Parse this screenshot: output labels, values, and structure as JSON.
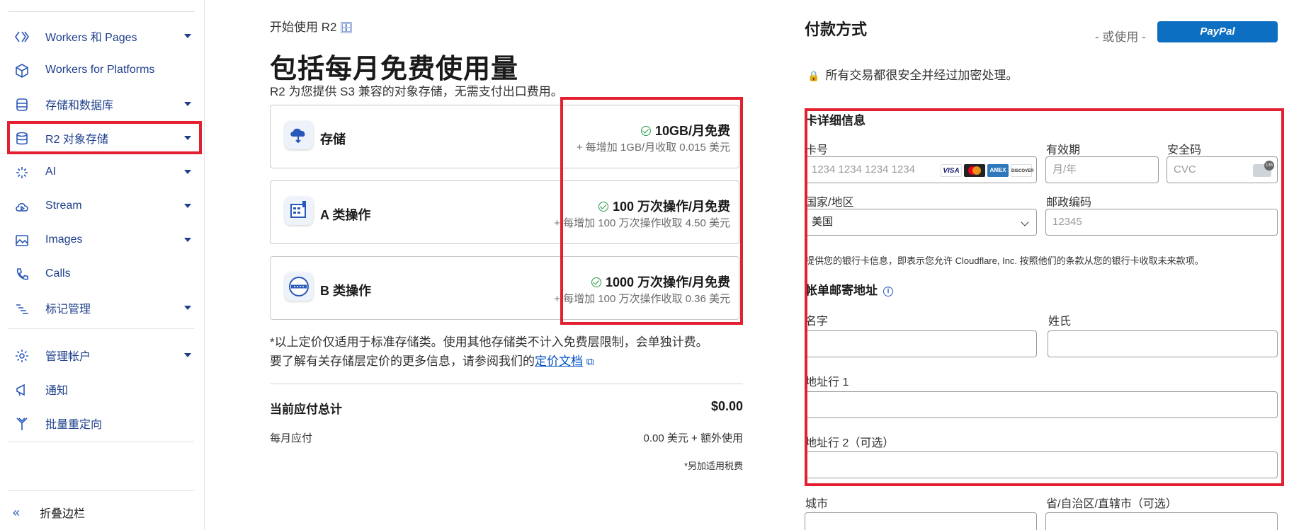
{
  "sidebar": {
    "items": [
      {
        "label": "Workers 和 Pages",
        "icon": "workers-icon"
      },
      {
        "label": "Workers for Platforms",
        "icon": "cube-icon"
      },
      {
        "label": "存储和数据库",
        "icon": "database-icon"
      },
      {
        "label": "R2 对象存储",
        "icon": "database-icon"
      },
      {
        "label": "AI",
        "icon": "sparkle-icon"
      },
      {
        "label": "Stream",
        "icon": "cloud-play-icon"
      },
      {
        "label": "Images",
        "icon": "image-icon"
      },
      {
        "label": "Calls",
        "icon": "phone-icon"
      },
      {
        "label": "标记管理",
        "icon": "tag-list-icon"
      },
      {
        "label": "管理帐户",
        "icon": "gear-icon"
      },
      {
        "label": "通知",
        "icon": "megaphone-icon"
      },
      {
        "label": "批量重定向",
        "icon": "redirect-icon"
      }
    ],
    "collapse_label": "折叠边栏"
  },
  "main": {
    "getting_started": "开始使用 R2",
    "title": "包括每月免费使用量",
    "description": "R2 为您提供 S3 兼容的对象存储，无需支付出口费用。",
    "plans": [
      {
        "name": "存储",
        "free": "10GB/月免费",
        "extra": "+ 每增加 1GB/月收取 0.015 美元"
      },
      {
        "name": "A 类操作",
        "free": "100 万次操作/月免费",
        "extra": "+ 每增加 100 万次操作收取 4.50 美元"
      },
      {
        "name": "B 类操作",
        "free": "1000 万次操作/月免费",
        "extra": "+ 每增加 100 万次操作收取 0.36 美元"
      }
    ],
    "footnote_line1": "*以上定价仅适用于标准存储类。使用其他存储类不计入免费层限制，会单独计费。",
    "footnote_line2": "要了解有关存储层定价的更多信息，请参阅我们的",
    "footnote_link": "定价文档",
    "total_label": "当前应付总计",
    "total_value": "$0.00",
    "monthly_label": "每月应付",
    "monthly_value": "0.00 美元 + 额外使用",
    "tax_note": "*另加适用税费"
  },
  "payment": {
    "title": "付款方式",
    "or_use": "- 或使用 -",
    "paypal": "PayPal",
    "secure_note": "所有交易都很安全并经过加密处理。",
    "card_section_title": "卡详细信息",
    "card_number_label": "卡号",
    "card_number_placeholder": "1234 1234 1234 1234",
    "expiry_label": "有效期",
    "expiry_placeholder": "月/年",
    "cvc_label": "安全码",
    "cvc_placeholder": "CVC",
    "country_label": "国家/地区",
    "country_value": "美国",
    "zip_label": "邮政编码",
    "zip_placeholder": "12345",
    "consent": "提供您的银行卡信息，即表示您允许 Cloudflare, Inc. 按照他们的条款从您的银行卡收取未来款项。",
    "billing_title": "帐单邮寄地址",
    "first_name_label": "名字",
    "last_name_label": "姓氏",
    "address1_label": "地址行 1",
    "address2_label": "地址行 2（可选）",
    "city_label": "城市",
    "state_label": "省/自治区/直辖市（可选）"
  },
  "colors": {
    "accent": "#0051c3",
    "highlight": "#e3202f",
    "paypal": "#0c6fc2",
    "check": "#2c9b45"
  }
}
